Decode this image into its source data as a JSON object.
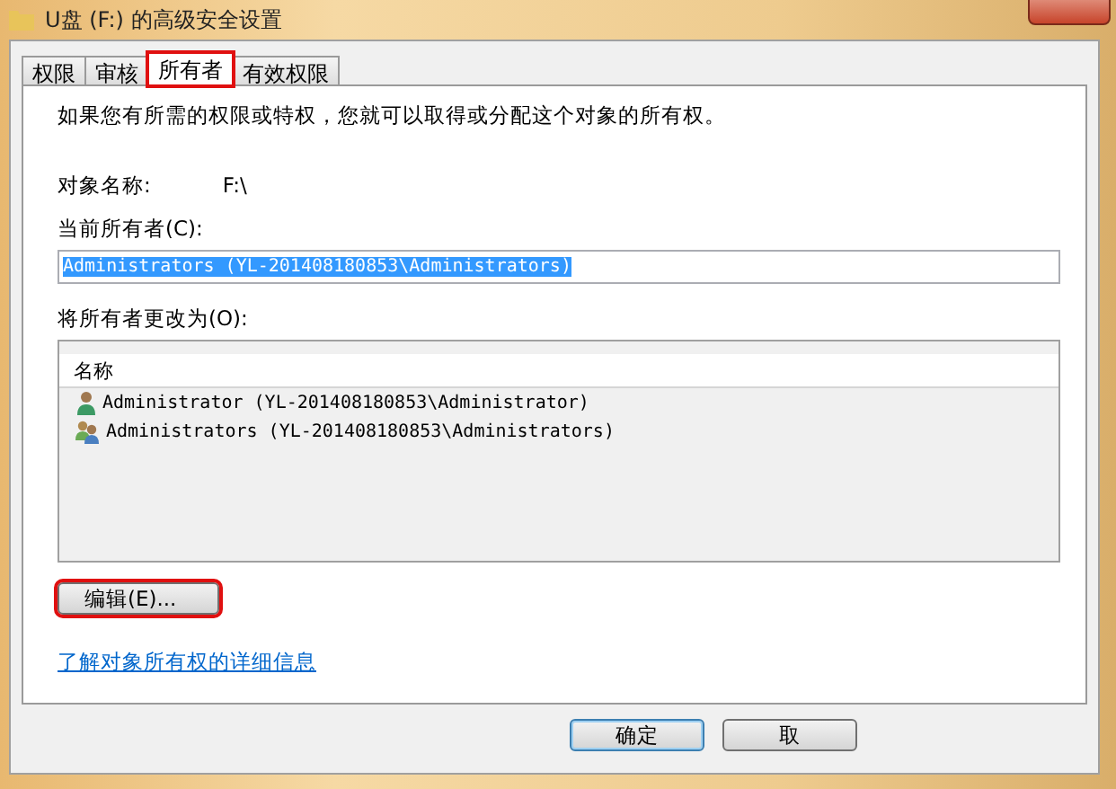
{
  "window": {
    "title": "U盘 (F:) 的高级安全设置"
  },
  "tabs": [
    {
      "label": "权限",
      "selected": false,
      "highlighted": false
    },
    {
      "label": "审核",
      "selected": false,
      "highlighted": false
    },
    {
      "label": "所有者",
      "selected": true,
      "highlighted": true
    },
    {
      "label": "有效权限",
      "selected": false,
      "highlighted": false
    }
  ],
  "intro": "如果您有所需的权限或特权，您就可以取得或分配这个对象的所有权。",
  "object_name": {
    "label": "对象名称:",
    "value": "F:\\"
  },
  "current_owner": {
    "label": "当前所有者(C):",
    "value": "Administrators (YL-201408180853\\Administrators)"
  },
  "change_owner": {
    "label": "将所有者更改为(O):",
    "columns": [
      "名称"
    ],
    "rows": [
      {
        "kind": "user",
        "name": "Administrator (YL-201408180853\\Administrator)"
      },
      {
        "kind": "group",
        "name": "Administrators (YL-201408180853\\Administrators)"
      }
    ]
  },
  "edit_button": {
    "label": "编辑(E)...",
    "highlighted": true
  },
  "link": "了解对象所有权的详细信息",
  "buttons": [
    {
      "label": "确定",
      "default": true
    },
    {
      "label": "取",
      "default": false
    }
  ]
}
